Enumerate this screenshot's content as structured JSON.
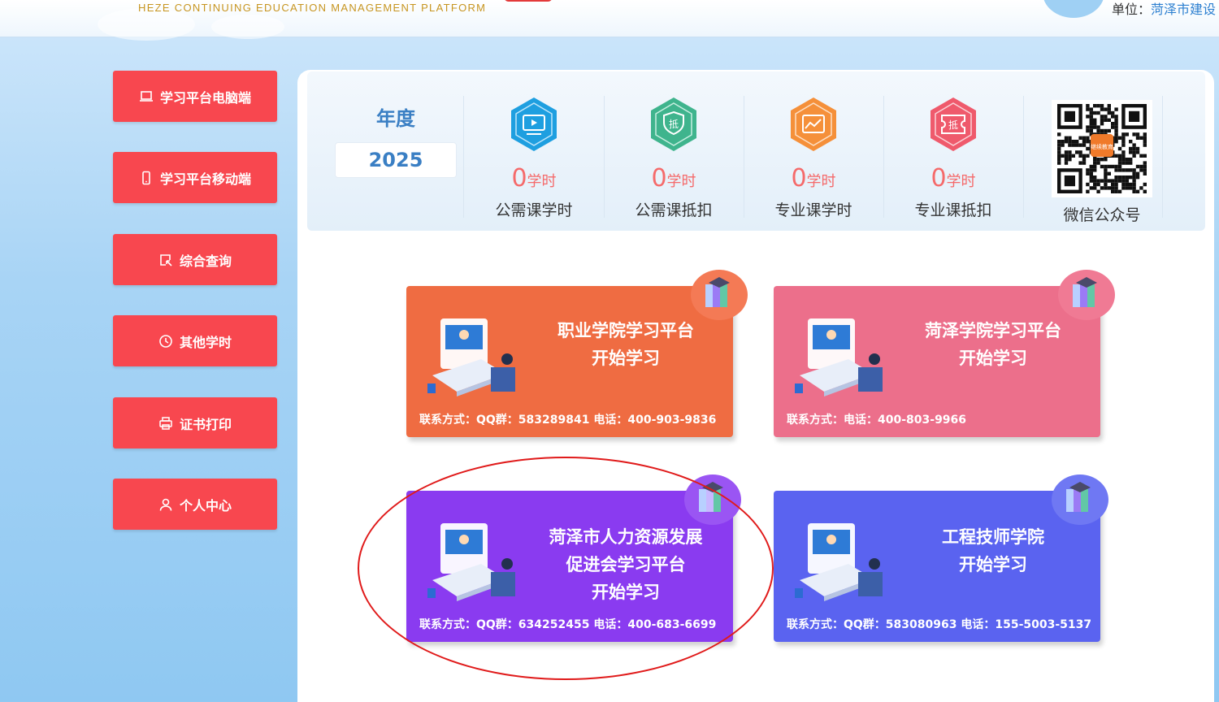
{
  "header": {
    "subtitle": "HEZE CONTINUING EDUCATION MANAGEMENT PLATFORM",
    "unit_label": "单位：",
    "unit_value": "菏泽市建设"
  },
  "sidebar": {
    "items": [
      {
        "label": "学习平台电脑端",
        "icon": "laptop-icon"
      },
      {
        "label": "学习平台移动端",
        "icon": "mobile-icon"
      },
      {
        "label": "综合查询",
        "icon": "query-icon"
      },
      {
        "label": "其他学时",
        "icon": "clock-icon"
      },
      {
        "label": "证书打印",
        "icon": "printer-icon"
      },
      {
        "label": "个人中心",
        "icon": "user-icon"
      }
    ]
  },
  "stats": {
    "year_label": "年度",
    "year_value": "2025",
    "items": [
      {
        "value": "0",
        "unit": "学时",
        "label": "公需课学时",
        "color": "#1e9fe0",
        "icon": "video-icon"
      },
      {
        "value": "0",
        "unit": "学时",
        "label": "公需课抵扣",
        "color": "#3fb48d",
        "icon": "deduct-shield-icon"
      },
      {
        "value": "0",
        "unit": "学时",
        "label": "专业课学时",
        "color": "#f5903a",
        "icon": "chart-icon"
      },
      {
        "value": "0",
        "unit": "学时",
        "label": "专业课抵扣",
        "color": "#ef5a6c",
        "icon": "deduct-ticket-icon"
      }
    ],
    "qr_label": "微信公众号",
    "qr_badge_text": "继续教育"
  },
  "cards": [
    {
      "title_lines": [
        "职业学院学习平台",
        "开始学习"
      ],
      "contact": "联系方式：QQ群：583289841 电话：400-903-9836",
      "color": "#ef6c42",
      "badge_color": "#f47a55"
    },
    {
      "title_lines": [
        "菏泽学院学习平台",
        "开始学习"
      ],
      "contact": "联系方式：电话：400-803-9966",
      "color": "#ec6f8b",
      "badge_color": "#f07a94"
    },
    {
      "title_lines": [
        "菏泽市人力资源发展",
        "促进会学习平台",
        "开始学习"
      ],
      "contact": "联系方式：QQ群：634252455 电话：400-683-6699",
      "color": "#8a3bf0",
      "badge_color": "#9a55f3"
    },
    {
      "title_lines": [
        "工程技师学院",
        "开始学习"
      ],
      "contact": "联系方式：QQ群：583080963 电话：155-5003-5137",
      "color": "#5a63f0",
      "badge_color": "#6f78f3"
    }
  ]
}
